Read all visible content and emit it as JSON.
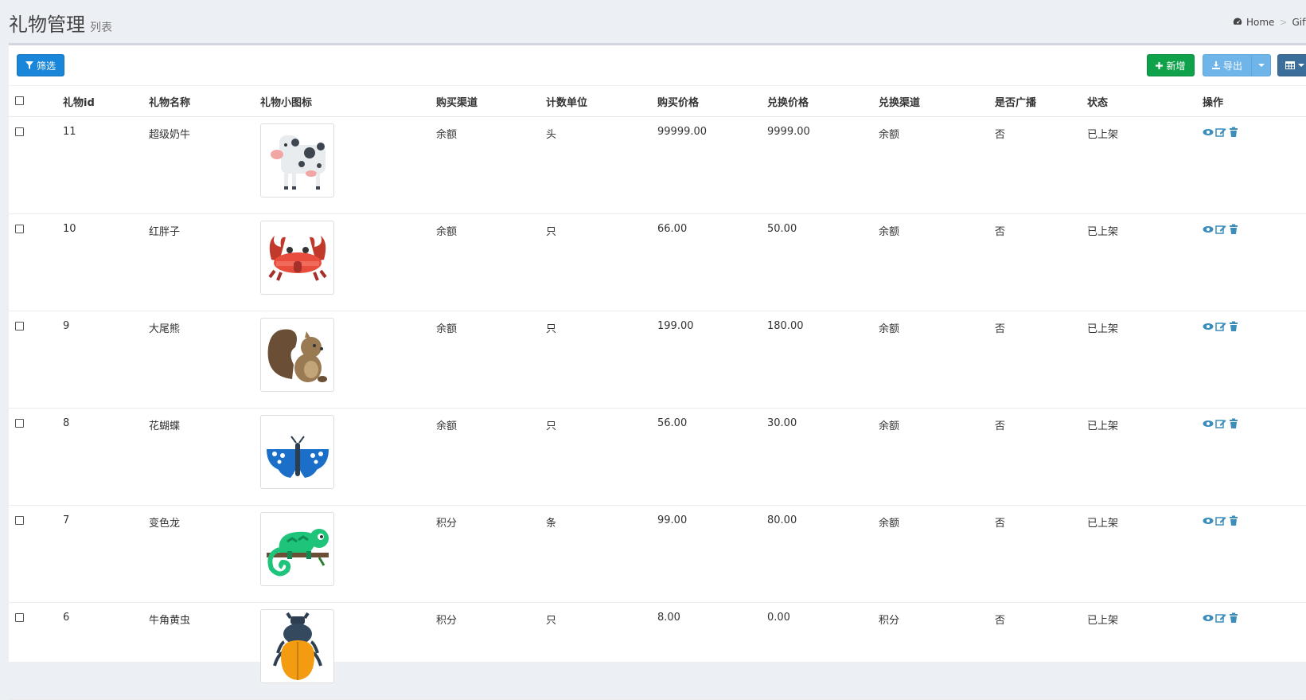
{
  "header": {
    "title": "礼物管理",
    "subtitle": "列表",
    "breadcrumb": [
      "Home",
      "Gift"
    ]
  },
  "toolbar": {
    "filter_label": "筛选",
    "add_label": "新增",
    "export_label": "导出"
  },
  "table": {
    "columns": [
      "礼物id",
      "礼物名称",
      "礼物小图标",
      "购买渠道",
      "计数单位",
      "购买价格",
      "兑换价格",
      "兑换渠道",
      "是否广播",
      "状态",
      "操作"
    ],
    "rows": [
      {
        "id": "11",
        "name": "超级奶牛",
        "icon": "cow-icon",
        "buy_channel": "余额",
        "unit": "头",
        "buy_price": "99999.00",
        "exchange_price": "9999.00",
        "exchange_channel": "余额",
        "broadcast": "否",
        "status": "已上架"
      },
      {
        "id": "10",
        "name": "红胖子",
        "icon": "crab-icon",
        "buy_channel": "余额",
        "unit": "只",
        "buy_price": "66.00",
        "exchange_price": "50.00",
        "exchange_channel": "余额",
        "broadcast": "否",
        "status": "已上架"
      },
      {
        "id": "9",
        "name": "大尾熊",
        "icon": "squirrel-icon",
        "buy_channel": "余额",
        "unit": "只",
        "buy_price": "199.00",
        "exchange_price": "180.00",
        "exchange_channel": "余额",
        "broadcast": "否",
        "status": "已上架"
      },
      {
        "id": "8",
        "name": "花蝴蝶",
        "icon": "butterfly-icon",
        "buy_channel": "余额",
        "unit": "只",
        "buy_price": "56.00",
        "exchange_price": "30.00",
        "exchange_channel": "余额",
        "broadcast": "否",
        "status": "已上架"
      },
      {
        "id": "7",
        "name": "变色龙",
        "icon": "chameleon-icon",
        "buy_channel": "积分",
        "unit": "条",
        "buy_price": "99.00",
        "exchange_price": "80.00",
        "exchange_channel": "余额",
        "broadcast": "否",
        "status": "已上架"
      },
      {
        "id": "6",
        "name": "牛角黄虫",
        "icon": "beetle-icon",
        "buy_channel": "积分",
        "unit": "只",
        "buy_price": "8.00",
        "exchange_price": "0.00",
        "exchange_channel": "积分",
        "broadcast": "否",
        "status": "已上架"
      }
    ]
  },
  "colors": {
    "filter_button": "#1a86d9",
    "add_button": "#10a14b",
    "export_button": "#6fb5ea",
    "columns_button": "#3c6e9c",
    "action_icon": "#3c8dbc"
  }
}
